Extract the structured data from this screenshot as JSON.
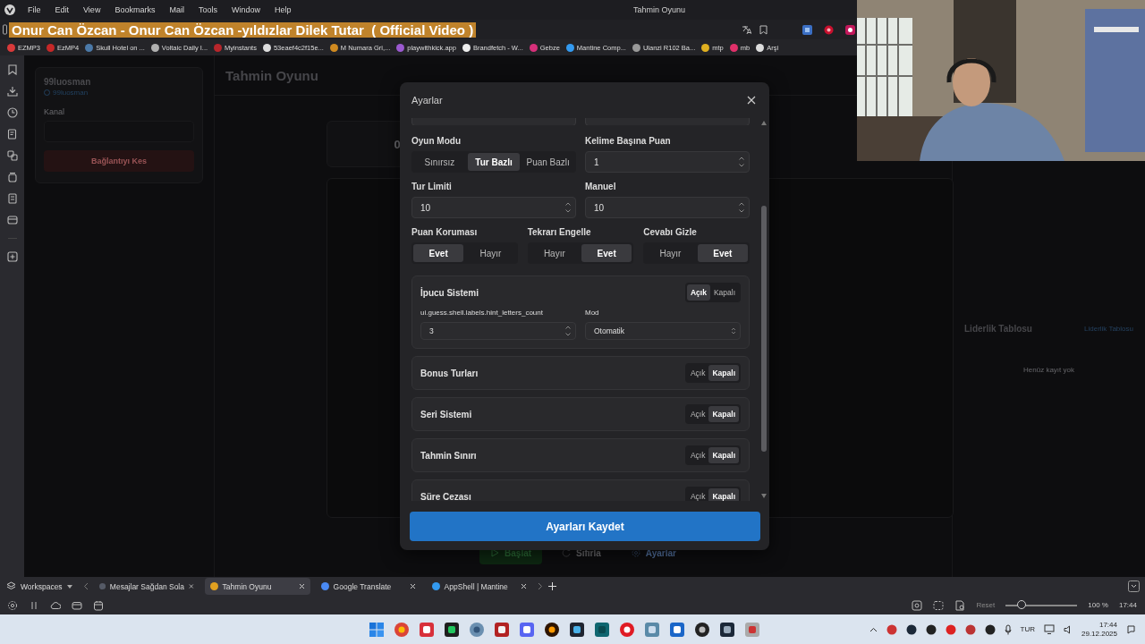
{
  "menu_bar": {
    "items": [
      "File",
      "Edit",
      "View",
      "Bookmarks",
      "Mail",
      "Tools",
      "Window",
      "Help"
    ],
    "title": "Tahmin Oyunu"
  },
  "address_bar": {
    "value": "Onur Can Özcan - Onur Can Özcan -yıldızlar Dilek Tutar  ( Official Video )",
    "selected": true
  },
  "bookmarks": [
    {
      "label": "EZMP3",
      "color": "#d93a3a"
    },
    {
      "label": "EzMP4",
      "color": "#c62828"
    },
    {
      "label": "Skull Hotel on ...",
      "color": "#4b79a8"
    },
    {
      "label": "Voltaic Daily I...",
      "color": "#b0b0b0"
    },
    {
      "label": "Myinstants",
      "color": "#b8262b"
    },
    {
      "label": "53eaef4c2f15e...",
      "color": "#dddddd"
    },
    {
      "label": "M Numara Gri,...",
      "color": "#d08a20"
    },
    {
      "label": "playwithkick.app",
      "color": "#9b59d0"
    },
    {
      "label": "Brandfetch - W...",
      "color": "#eeeeee"
    },
    {
      "label": "Gebze",
      "color": "#d6307a"
    },
    {
      "label": "Mantine Comp...",
      "color": "#339af0"
    },
    {
      "label": "Ulanzi R102 Ba...",
      "color": "#999999"
    },
    {
      "label": "mtp",
      "color": "#e0b020"
    },
    {
      "label": "mb",
      "color": "#e0306a"
    },
    {
      "label": "Arşi",
      "color": "#dddddd"
    }
  ],
  "app": {
    "user": "99luosman",
    "handle": "99luosman",
    "channel_label": "Kanal",
    "disconnect": "Bağlantıyı Kes",
    "title": "Tahmin Oyunu",
    "score": "0",
    "leaderboard": {
      "title": "Liderlik Tablosu",
      "link": "Liderlik Tablosu",
      "empty": "Henüz kayıt yok"
    },
    "actions": [
      {
        "kind": "start",
        "label": "Başlat"
      },
      {
        "kind": "reset",
        "label": "Sıfırla"
      },
      {
        "kind": "settings",
        "label": "Ayarlar"
      }
    ]
  },
  "dialog": {
    "title": "Ayarlar",
    "rows": [
      {
        "kind": "pair",
        "items": [
          {
            "kind": "segmented",
            "label": "Oyun Modu",
            "options": [
              {
                "label": "Sınırsız",
                "selected": false
              },
              {
                "label": "Tur Bazlı",
                "selected": true
              },
              {
                "label": "Puan Bazlı",
                "selected": false
              }
            ]
          },
          {
            "kind": "number",
            "label": "Kelime Başına Puan",
            "value": "1"
          }
        ]
      },
      {
        "kind": "pair",
        "items": [
          {
            "kind": "number",
            "label": "Tur Limiti",
            "value": "10"
          },
          {
            "kind": "number",
            "label": "Manuel",
            "value": "10"
          }
        ]
      },
      {
        "kind": "triple",
        "items": [
          {
            "kind": "segmented",
            "label": "Puan Koruması",
            "options": [
              {
                "label": "Evet",
                "selected": true
              },
              {
                "label": "Hayır",
                "selected": false
              }
            ]
          },
          {
            "kind": "segmented",
            "label": "Tekrarı Engelle",
            "options": [
              {
                "label": "Hayır",
                "selected": false
              },
              {
                "label": "Evet",
                "selected": true
              }
            ]
          },
          {
            "kind": "segmented",
            "label": "Cevabı Gizle",
            "options": [
              {
                "label": "Hayır",
                "selected": false
              },
              {
                "label": "Evet",
                "selected": true
              }
            ]
          }
        ]
      }
    ],
    "features": [
      {
        "title": "İpucu Sistemi",
        "options": [
          {
            "label": "Açık",
            "selected": true
          },
          {
            "label": "Kapalı",
            "selected": false
          }
        ],
        "fields": [
          {
            "kind": "number",
            "label": "ui.guess.shell.labels.hint_letters_count",
            "value": "3"
          },
          {
            "kind": "select",
            "label": "Mod",
            "value": "Otomatik"
          }
        ]
      },
      {
        "title": "Bonus Turları",
        "options": [
          {
            "label": "Açık",
            "selected": false
          },
          {
            "label": "Kapalı",
            "selected": true
          }
        ]
      },
      {
        "title": "Seri Sistemi",
        "options": [
          {
            "label": "Açık",
            "selected": false
          },
          {
            "label": "Kapalı",
            "selected": true
          }
        ]
      },
      {
        "title": "Tahmin Sınırı",
        "options": [
          {
            "label": "Açık",
            "selected": false
          },
          {
            "label": "Kapalı",
            "selected": true
          }
        ]
      },
      {
        "title": "Süre Cezası",
        "options": [
          {
            "label": "Açık",
            "selected": false
          },
          {
            "label": "Kapalı",
            "selected": true
          }
        ]
      }
    ],
    "save": "Ayarları Kaydet"
  },
  "tabs": {
    "workspaces": "Workspaces",
    "items": [
      {
        "label": "Mesajlar Sağdan Sola",
        "selected": false,
        "color": "#555a66"
      },
      {
        "label": "Tahmin Oyunu",
        "selected": true,
        "color": "#e0a020"
      },
      {
        "label": "Google Translate",
        "selected": false,
        "color": "#4a8af4"
      },
      {
        "label": "AppShell | Mantine",
        "selected": false,
        "color": "#339af0"
      }
    ]
  },
  "status_bar": {
    "reset": "Reset",
    "zoom": {
      "level": 0.22,
      "reading": "100 %"
    },
    "time": "17:44"
  },
  "taskbar": {
    "language": "TUR",
    "time": "17:44",
    "date": "29.12.2025"
  }
}
